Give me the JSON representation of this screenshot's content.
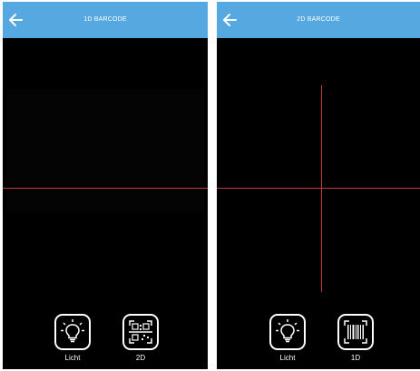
{
  "screens": [
    {
      "title": "1D BARCODE",
      "controls": [
        {
          "label": "Licht",
          "icon": "lightbulb-icon"
        },
        {
          "label": "2D",
          "icon": "qr-code-icon"
        }
      ]
    },
    {
      "title": "2D BARCODE",
      "controls": [
        {
          "label": "Licht",
          "icon": "lightbulb-icon"
        },
        {
          "label": "1D",
          "icon": "barcode-icon"
        }
      ]
    }
  ],
  "colors": {
    "app_bar": "#55a9e0",
    "viewfinder": "#000000",
    "scan_line": "#c23a3a",
    "text": "#ffffff"
  }
}
